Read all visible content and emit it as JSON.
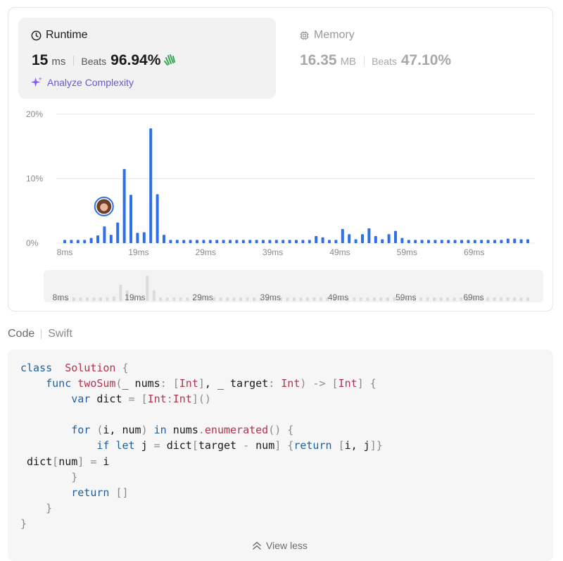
{
  "runtime": {
    "title": "Runtime",
    "value": "15",
    "unit": "ms",
    "beats_label": "Beats",
    "beats_value": "96.94%"
  },
  "memory": {
    "title": "Memory",
    "value": "16.35",
    "unit": "MB",
    "beats_label": "Beats",
    "beats_value": "47.10%"
  },
  "analyze_label": "Analyze Complexity",
  "colors": {
    "bar": "#2f6fea",
    "accent": "#6e56cf",
    "hands": "#3aa655"
  },
  "chart_data": {
    "type": "bar",
    "ylabels": [
      "20%",
      "10%",
      "0%"
    ],
    "ylim": [
      0,
      20
    ],
    "x_tick_labels": [
      "8ms",
      "19ms",
      "29ms",
      "39ms",
      "49ms",
      "59ms",
      "69ms"
    ],
    "x_start_ms": 8,
    "x_end_ms": 77,
    "values": [
      0.5,
      0.5,
      0.5,
      0.5,
      0.8,
      1.2,
      2.6,
      1.3,
      3.2,
      11.5,
      7.5,
      1.6,
      1.7,
      17.8,
      7.6,
      1.3,
      0.5,
      0.5,
      0.5,
      0.5,
      0.5,
      0.5,
      0.5,
      0.5,
      0.5,
      0.5,
      0.5,
      0.5,
      0.5,
      0.5,
      0.5,
      0.5,
      0.5,
      0.5,
      0.5,
      0.5,
      0.5,
      0.5,
      1.1,
      0.9,
      0.5,
      0.5,
      2.2,
      1.4,
      0.6,
      1.4,
      2.3,
      1.1,
      0.6,
      1.4,
      1.9,
      0.8,
      0.5,
      0.5,
      0.5,
      0.5,
      0.5,
      0.5,
      0.5,
      0.5,
      0.5,
      0.5,
      0.5,
      0.5,
      0.5,
      0.5,
      0.5,
      0.7,
      0.7,
      0.6,
      0.6
    ],
    "user_value_ms": 15,
    "grid": true
  },
  "code": {
    "label": "Code",
    "language": "Swift",
    "lines": [
      [
        [
          "kw",
          "class"
        ],
        [
          "",
          "  "
        ],
        [
          "ty",
          "Solution"
        ],
        [
          "br",
          " {"
        ]
      ],
      [
        [
          "",
          "    "
        ],
        [
          "kw",
          "func"
        ],
        [
          "",
          " "
        ],
        [
          "fn",
          "twoSum"
        ],
        [
          "br",
          "("
        ],
        [
          "",
          "_ nums"
        ],
        [
          "op",
          ":"
        ],
        [
          "",
          " "
        ],
        [
          "br",
          "["
        ],
        [
          "ty",
          "Int"
        ],
        [
          "br",
          "]"
        ],
        [
          "",
          ", _ target"
        ],
        [
          "op",
          ":"
        ],
        [
          "",
          " "
        ],
        [
          "ty",
          "Int"
        ],
        [
          "br",
          ")"
        ],
        [
          "",
          " "
        ],
        [
          "op",
          "->"
        ],
        [
          "",
          " "
        ],
        [
          "br",
          "["
        ],
        [
          "ty",
          "Int"
        ],
        [
          "br",
          "]"
        ],
        [
          "br",
          " {"
        ]
      ],
      [
        [
          "",
          "        "
        ],
        [
          "kw",
          "var"
        ],
        [
          "",
          " dict "
        ],
        [
          "op",
          "="
        ],
        [
          "",
          " "
        ],
        [
          "br",
          "["
        ],
        [
          "ty",
          "Int"
        ],
        [
          "op",
          ":"
        ],
        [
          "ty",
          "Int"
        ],
        [
          "br",
          "]()"
        ]
      ],
      [],
      [
        [
          "",
          "        "
        ],
        [
          "kw",
          "for"
        ],
        [
          "",
          " "
        ],
        [
          "br",
          "("
        ],
        [
          "",
          "i, num"
        ],
        [
          "br",
          ")"
        ],
        [
          "",
          " "
        ],
        [
          "kw",
          "in"
        ],
        [
          "",
          " nums"
        ],
        [
          "op",
          "."
        ],
        [
          "fn",
          "enumerated"
        ],
        [
          "br",
          "()"
        ],
        [
          "br",
          " {"
        ]
      ],
      [
        [
          "",
          "            "
        ],
        [
          "kw",
          "if"
        ],
        [
          "",
          " "
        ],
        [
          "kw",
          "let"
        ],
        [
          "",
          " j "
        ],
        [
          "op",
          "="
        ],
        [
          "",
          " dict"
        ],
        [
          "br",
          "["
        ],
        [
          "",
          "target "
        ],
        [
          "op",
          "-"
        ],
        [
          "",
          " num"
        ],
        [
          "br",
          "]"
        ],
        [
          "",
          " "
        ],
        [
          "br",
          "{"
        ],
        [
          "kw",
          "return"
        ],
        [
          "",
          " "
        ],
        [
          "br",
          "["
        ],
        [
          "",
          "i, j"
        ],
        [
          "br",
          "]}"
        ]
      ],
      [
        [
          "",
          ""
        ],
        [
          "",
          " dict"
        ],
        [
          "br",
          "["
        ],
        [
          "",
          "num"
        ],
        [
          "br",
          "]"
        ],
        [
          "",
          " "
        ],
        [
          "op",
          "="
        ],
        [
          "",
          " i"
        ]
      ],
      [
        [
          "",
          "        "
        ],
        [
          "br",
          "}"
        ]
      ],
      [
        [
          "",
          "        "
        ],
        [
          "kw",
          "return"
        ],
        [
          "",
          " "
        ],
        [
          "br",
          "[]"
        ]
      ],
      [
        [
          "",
          "    "
        ],
        [
          "br",
          "}"
        ]
      ],
      [
        [
          "br",
          "}"
        ]
      ]
    ]
  },
  "view_less": "View less"
}
